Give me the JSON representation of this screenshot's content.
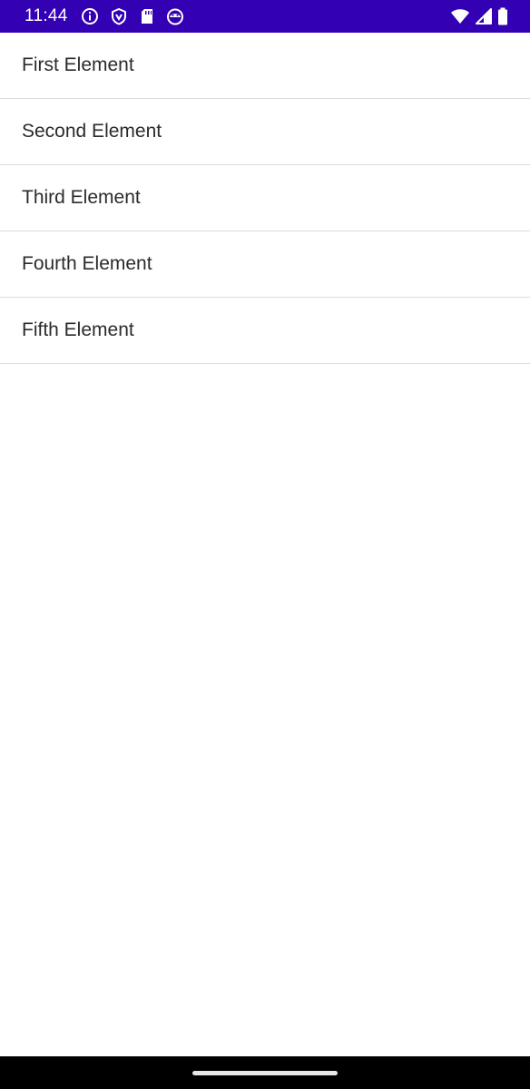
{
  "status_bar": {
    "time": "11:44",
    "background_color": "#3300b3",
    "left_icons": [
      "info-icon",
      "shield-icon",
      "sd-card-icon",
      "android-face-icon"
    ],
    "right_icons": [
      "wifi-icon",
      "cell-signal-icon",
      "battery-icon"
    ]
  },
  "list": {
    "items": [
      {
        "label": "First Element"
      },
      {
        "label": "Second Element"
      },
      {
        "label": "Third Element"
      },
      {
        "label": "Fourth Element"
      },
      {
        "label": "Fifth Element"
      }
    ]
  },
  "navigation_bar": {
    "background_color": "#000000",
    "handle": "home-gesture-handle"
  }
}
